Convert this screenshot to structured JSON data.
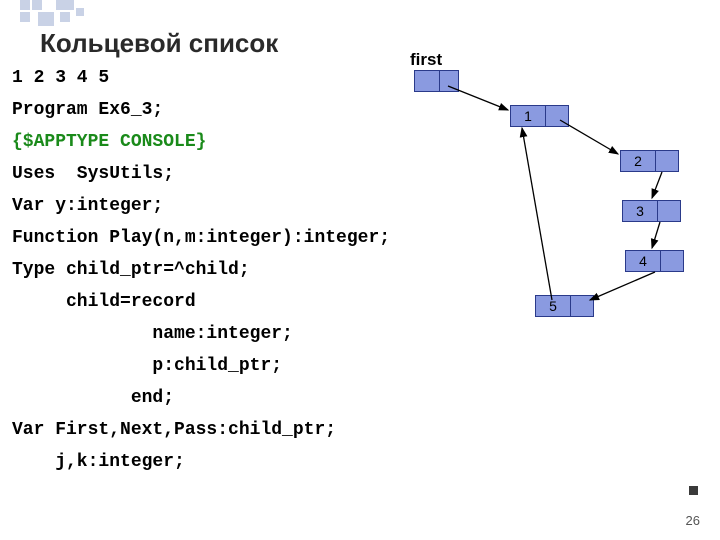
{
  "title": "Кольцевой список",
  "code_lines": [
    {
      "text": "1 2 3 4 5",
      "cls": ""
    },
    {
      "text": "Program Ex6_3;",
      "cls": ""
    },
    {
      "text": "{$APPTYPE CONSOLE}",
      "cls": "green"
    },
    {
      "text": "Uses  SysUtils;",
      "cls": ""
    },
    {
      "text": "Var y:integer;",
      "cls": ""
    },
    {
      "text": "Function Play(n,m:integer):integer;",
      "cls": ""
    },
    {
      "text": "Type child_ptr=^child;",
      "cls": ""
    },
    {
      "text": "     child=record",
      "cls": ""
    },
    {
      "text": "             name:integer;",
      "cls": ""
    },
    {
      "text": "             p:child_ptr;",
      "cls": ""
    },
    {
      "text": "           end;",
      "cls": ""
    },
    {
      "text": "Var First,Next,Pass:child_ptr;",
      "cls": ""
    },
    {
      "text": "    j,k:integer;",
      "cls": ""
    }
  ],
  "diagram": {
    "first_label": "first",
    "nodes": [
      "1",
      "2",
      "3",
      "4",
      "5"
    ]
  },
  "page_number": "26"
}
